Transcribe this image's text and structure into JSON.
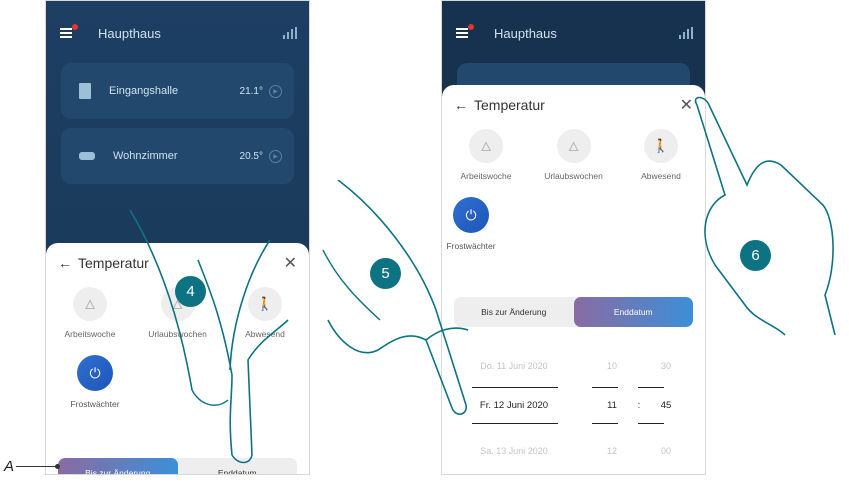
{
  "left_phone": {
    "home_title": "Haupthaus",
    "rooms": [
      {
        "name": "Eingangshalle",
        "temp": "21.1°"
      },
      {
        "name": "Wohnzimmer",
        "temp": "20.5°"
      }
    ],
    "sheet": {
      "title": "Temperatur",
      "modes": [
        {
          "label": "Arbeitswoche",
          "icon": "flame-icon"
        },
        {
          "label": "Urlaubswochen",
          "icon": "flame-icon"
        },
        {
          "label": "Abwesend",
          "icon": "walking-person-icon"
        }
      ],
      "frost_label": "Frostwächter",
      "toggle": {
        "option_1": "Bis zur Änderung",
        "option_2": "Enddatum",
        "selected": "option_1"
      }
    }
  },
  "right_phone": {
    "home_title": "Haupthaus",
    "sheet": {
      "title": "Temperatur",
      "modes": [
        {
          "label": "Arbeitswoche",
          "icon": "flame-icon"
        },
        {
          "label": "Urlaubswochen",
          "icon": "flame-icon"
        },
        {
          "label": "Abwesend",
          "icon": "walking-person-icon"
        }
      ],
      "frost_label": "Frostwächter",
      "toggle": {
        "option_1": "Bis zur Änderung",
        "option_2": "Enddatum",
        "selected": "option_2"
      },
      "date_picker": {
        "rows": [
          {
            "date": "Do. 11 Juni 2020",
            "hour": "10",
            "minute": "30"
          },
          {
            "date": "Fr. 12 Juni 2020",
            "hour": "11",
            "minute": "45"
          },
          {
            "date": "Sa. 13 Juni 2020",
            "hour": "12",
            "minute": "00"
          }
        ],
        "separator": ":"
      }
    }
  },
  "steps": {
    "step_4": "4",
    "step_5": "5",
    "step_6": "6"
  },
  "callout": {
    "label": "A"
  },
  "colors": {
    "app_bg": "#1d3f63",
    "accent_blue": "#2f6fd0",
    "badge": "#0d7383",
    "toggle_start": "#8a6ba2",
    "toggle_end": "#3c8fd8"
  }
}
